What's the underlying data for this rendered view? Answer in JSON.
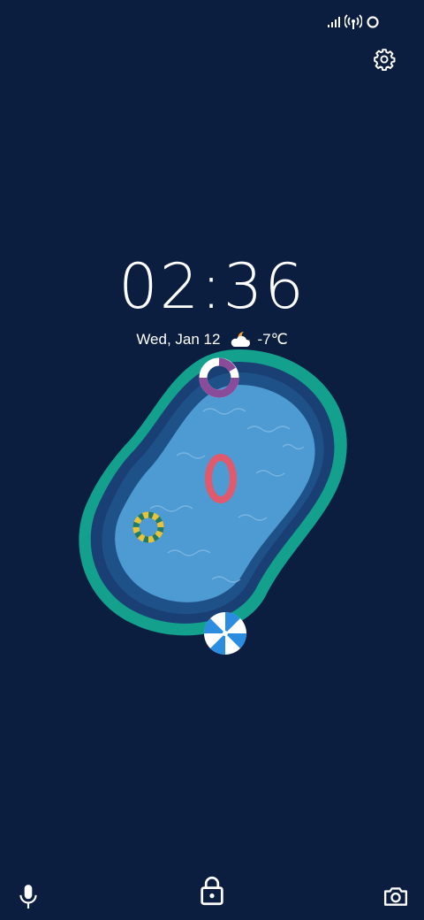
{
  "status_bar": {
    "icons": [
      "signal-bars-icon",
      "hotspot-icon",
      "ring-icon"
    ]
  },
  "header": {
    "settings_icon": "gear-icon"
  },
  "lock_screen": {
    "time": "02:36",
    "date": "Wed, Jan 12",
    "weather_icon": "partly-cloudy-night-icon",
    "temperature": "-7℃"
  },
  "wallpaper": {
    "name": "pool-illustration",
    "colors": {
      "background": "#0b1e40",
      "pool_rim": "#13a18e",
      "pool_edge": "#1f4f86",
      "water": "#4e9ad2",
      "float_red": "#e05a6e",
      "float_purple": "#8a4c9a",
      "float_yellow": "#e8c23a",
      "umbrella": "#2a8de0"
    }
  },
  "bottom_bar": {
    "left_icon": "microphone-icon",
    "center_icon": "lock-icon",
    "right_icon": "camera-icon"
  }
}
